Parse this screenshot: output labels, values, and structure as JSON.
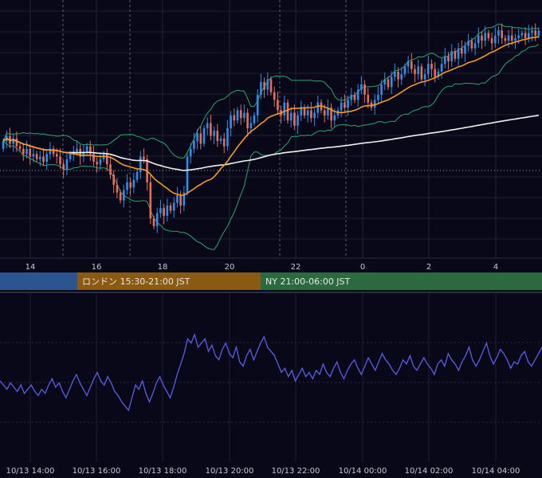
{
  "chart_data": [
    {
      "type": "candlestick",
      "title": "",
      "x_ticks": [
        "14",
        "16",
        "18",
        "20",
        "22",
        "0",
        "2",
        "4"
      ],
      "grid": true,
      "overlays": [
        "bollinger-bands",
        "moving-average-orange",
        "moving-average-white"
      ],
      "colors": {
        "up": "#2f8fe6",
        "down": "#e86e5c",
        "band": "#2aa56a",
        "ma_fast": "#f39a2a",
        "ma_slow": "#f0f0f0"
      },
      "candles": [
        {
          "o": 47,
          "c": 50
        },
        {
          "o": 50,
          "c": 52
        },
        {
          "o": 52,
          "c": 49
        },
        {
          "o": 49,
          "c": 51
        },
        {
          "o": 51,
          "c": 48
        },
        {
          "o": 48,
          "c": 47
        },
        {
          "o": 47,
          "c": 45
        },
        {
          "o": 45,
          "c": 47
        },
        {
          "o": 47,
          "c": 44
        },
        {
          "o": 44,
          "c": 45
        },
        {
          "o": 45,
          "c": 43
        },
        {
          "o": 43,
          "c": 44
        },
        {
          "o": 44,
          "c": 42
        },
        {
          "o": 42,
          "c": 45
        },
        {
          "o": 45,
          "c": 47
        },
        {
          "o": 47,
          "c": 45
        },
        {
          "o": 45,
          "c": 44
        },
        {
          "o": 44,
          "c": 41
        },
        {
          "o": 41,
          "c": 39
        },
        {
          "o": 39,
          "c": 43
        },
        {
          "o": 43,
          "c": 45
        },
        {
          "o": 45,
          "c": 46
        },
        {
          "o": 46,
          "c": 47
        },
        {
          "o": 47,
          "c": 44
        },
        {
          "o": 44,
          "c": 46
        },
        {
          "o": 46,
          "c": 48
        },
        {
          "o": 48,
          "c": 45
        },
        {
          "o": 45,
          "c": 42
        },
        {
          "o": 42,
          "c": 41
        },
        {
          "o": 41,
          "c": 43
        },
        {
          "o": 43,
          "c": 45
        },
        {
          "o": 45,
          "c": 41
        },
        {
          "o": 41,
          "c": 37
        },
        {
          "o": 37,
          "c": 33
        },
        {
          "o": 33,
          "c": 30
        },
        {
          "o": 30,
          "c": 27
        },
        {
          "o": 27,
          "c": 31
        },
        {
          "o": 31,
          "c": 34
        },
        {
          "o": 34,
          "c": 32
        },
        {
          "o": 32,
          "c": 35
        },
        {
          "o": 35,
          "c": 38
        },
        {
          "o": 38,
          "c": 44
        },
        {
          "o": 44,
          "c": 43
        },
        {
          "o": 43,
          "c": 34
        },
        {
          "o": 34,
          "c": 20
        },
        {
          "o": 20,
          "c": 17
        },
        {
          "o": 17,
          "c": 22
        },
        {
          "o": 22,
          "c": 24
        },
        {
          "o": 24,
          "c": 21
        },
        {
          "o": 21,
          "c": 25
        },
        {
          "o": 25,
          "c": 23
        },
        {
          "o": 23,
          "c": 26
        },
        {
          "o": 26,
          "c": 29
        },
        {
          "o": 29,
          "c": 25
        },
        {
          "o": 25,
          "c": 30
        },
        {
          "o": 30,
          "c": 44
        },
        {
          "o": 44,
          "c": 47
        },
        {
          "o": 47,
          "c": 50
        },
        {
          "o": 50,
          "c": 53
        },
        {
          "o": 53,
          "c": 49
        },
        {
          "o": 49,
          "c": 55
        },
        {
          "o": 55,
          "c": 57
        },
        {
          "o": 57,
          "c": 52
        },
        {
          "o": 52,
          "c": 54
        },
        {
          "o": 54,
          "c": 50
        },
        {
          "o": 50,
          "c": 51
        },
        {
          "o": 51,
          "c": 48
        },
        {
          "o": 48,
          "c": 55
        },
        {
          "o": 55,
          "c": 60
        },
        {
          "o": 60,
          "c": 58
        },
        {
          "o": 58,
          "c": 62
        },
        {
          "o": 62,
          "c": 59
        },
        {
          "o": 59,
          "c": 61
        },
        {
          "o": 61,
          "c": 55
        },
        {
          "o": 55,
          "c": 57
        },
        {
          "o": 57,
          "c": 60
        },
        {
          "o": 60,
          "c": 68
        },
        {
          "o": 68,
          "c": 73
        },
        {
          "o": 73,
          "c": 70
        },
        {
          "o": 70,
          "c": 74
        },
        {
          "o": 74,
          "c": 69
        },
        {
          "o": 69,
          "c": 66
        },
        {
          "o": 66,
          "c": 62
        },
        {
          "o": 62,
          "c": 60
        },
        {
          "o": 60,
          "c": 65
        },
        {
          "o": 65,
          "c": 58
        },
        {
          "o": 58,
          "c": 61
        },
        {
          "o": 61,
          "c": 56
        },
        {
          "o": 56,
          "c": 60
        },
        {
          "o": 60,
          "c": 63
        },
        {
          "o": 63,
          "c": 60
        },
        {
          "o": 60,
          "c": 62
        },
        {
          "o": 62,
          "c": 59
        },
        {
          "o": 59,
          "c": 61
        },
        {
          "o": 61,
          "c": 65
        },
        {
          "o": 65,
          "c": 62
        },
        {
          "o": 62,
          "c": 60
        },
        {
          "o": 60,
          "c": 63
        },
        {
          "o": 63,
          "c": 58
        },
        {
          "o": 58,
          "c": 60
        },
        {
          "o": 60,
          "c": 62
        },
        {
          "o": 62,
          "c": 65
        },
        {
          "o": 65,
          "c": 63
        },
        {
          "o": 63,
          "c": 66
        },
        {
          "o": 66,
          "c": 68
        },
        {
          "o": 68,
          "c": 66
        },
        {
          "o": 66,
          "c": 70
        },
        {
          "o": 70,
          "c": 72
        },
        {
          "o": 72,
          "c": 68
        },
        {
          "o": 68,
          "c": 65
        },
        {
          "o": 65,
          "c": 63
        },
        {
          "o": 63,
          "c": 66
        },
        {
          "o": 66,
          "c": 68
        },
        {
          "o": 68,
          "c": 72
        },
        {
          "o": 72,
          "c": 74
        },
        {
          "o": 74,
          "c": 71
        },
        {
          "o": 71,
          "c": 75
        },
        {
          "o": 75,
          "c": 77
        },
        {
          "o": 77,
          "c": 74
        },
        {
          "o": 74,
          "c": 76
        },
        {
          "o": 76,
          "c": 79
        },
        {
          "o": 79,
          "c": 81
        },
        {
          "o": 81,
          "c": 78
        },
        {
          "o": 78,
          "c": 76
        },
        {
          "o": 76,
          "c": 79
        },
        {
          "o": 79,
          "c": 74
        },
        {
          "o": 74,
          "c": 76
        },
        {
          "o": 76,
          "c": 80
        },
        {
          "o": 80,
          "c": 78
        },
        {
          "o": 78,
          "c": 75
        },
        {
          "o": 75,
          "c": 77
        },
        {
          "o": 77,
          "c": 80
        },
        {
          "o": 80,
          "c": 83
        },
        {
          "o": 83,
          "c": 81
        },
        {
          "o": 81,
          "c": 85
        },
        {
          "o": 85,
          "c": 82
        },
        {
          "o": 82,
          "c": 86
        },
        {
          "o": 86,
          "c": 84
        },
        {
          "o": 84,
          "c": 87
        },
        {
          "o": 87,
          "c": 89
        },
        {
          "o": 89,
          "c": 86
        },
        {
          "o": 86,
          "c": 88
        },
        {
          "o": 88,
          "c": 91
        },
        {
          "o": 91,
          "c": 89
        },
        {
          "o": 89,
          "c": 92
        },
        {
          "o": 92,
          "c": 90
        },
        {
          "o": 90,
          "c": 88
        },
        {
          "o": 88,
          "c": 91
        },
        {
          "o": 91,
          "c": 93
        },
        {
          "o": 93,
          "c": 90
        },
        {
          "o": 90,
          "c": 89
        },
        {
          "o": 89,
          "c": 91
        },
        {
          "o": 91,
          "c": 89
        },
        {
          "o": 89,
          "c": 90
        },
        {
          "o": 90,
          "c": 91
        },
        {
          "o": 91,
          "c": 92
        },
        {
          "o": 92,
          "c": 90
        },
        {
          "o": 90,
          "c": 92
        },
        {
          "o": 92,
          "c": 93
        },
        {
          "o": 93,
          "c": 91
        },
        {
          "o": 91,
          "c": 93
        }
      ]
    },
    {
      "type": "line",
      "title": "",
      "x_ticks": [
        "10/13 14:00",
        "10/13 16:00",
        "10/13 18:00",
        "10/13 20:00",
        "10/13 22:00",
        "10/14 00:00",
        "10/14 02:00",
        "10/14 04:00"
      ],
      "grid": true,
      "color": "#5a5ee8",
      "values": [
        52,
        50,
        48,
        51,
        49,
        47,
        50,
        46,
        48,
        50,
        47,
        45,
        48,
        46,
        50,
        53,
        49,
        51,
        47,
        44,
        48,
        52,
        55,
        51,
        48,
        45,
        49,
        53,
        56,
        52,
        50,
        54,
        51,
        47,
        45,
        42,
        40,
        38,
        44,
        50,
        48,
        52,
        46,
        42,
        46,
        51,
        54,
        50,
        47,
        44,
        49,
        55,
        60,
        65,
        72,
        70,
        74,
        68,
        70,
        72,
        66,
        69,
        64,
        62,
        67,
        70,
        65,
        63,
        68,
        61,
        59,
        64,
        67,
        62,
        66,
        70,
        73,
        68,
        66,
        64,
        60,
        56,
        58,
        54,
        57,
        52,
        55,
        58,
        54,
        56,
        53,
        57,
        55,
        60,
        56,
        54,
        58,
        61,
        56,
        53,
        57,
        60,
        62,
        58,
        55,
        59,
        63,
        60,
        57,
        61,
        65,
        62,
        60,
        57,
        55,
        58,
        62,
        60,
        64,
        59,
        57,
        60,
        63,
        60,
        58,
        55,
        60,
        62,
        59,
        65,
        62,
        60,
        57,
        61,
        64,
        68,
        62,
        59,
        62,
        66,
        70,
        64,
        60,
        63,
        67,
        65,
        62,
        58,
        61,
        60,
        64,
        66,
        61,
        59,
        62,
        65,
        68
      ]
    }
  ],
  "sessions": [
    {
      "label": "",
      "color": "#2a5590"
    },
    {
      "label": "ロンドン 15:30-21:00 JST",
      "color": "#8a5a12"
    },
    {
      "label": "NY 21:00-06:00 JST",
      "color": "#2a6a3e"
    }
  ]
}
